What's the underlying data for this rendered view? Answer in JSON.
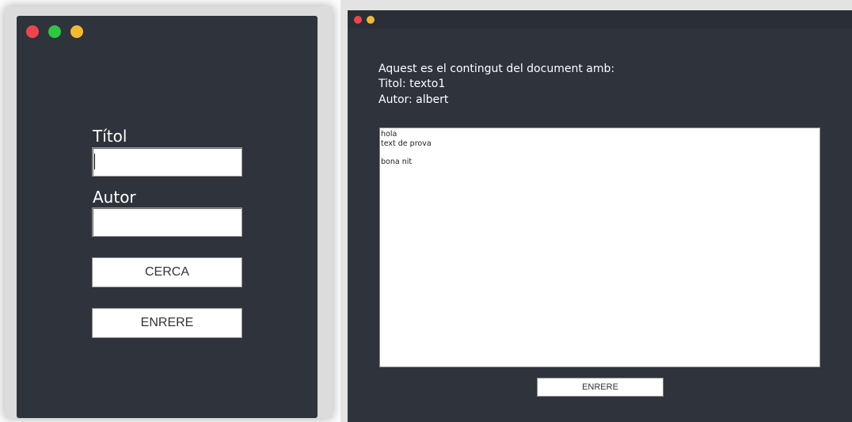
{
  "search_window": {
    "title_label": "Títol",
    "author_label": "Autor",
    "title_value": "",
    "author_value": "",
    "search_button": "CERCA",
    "back_button": "ENRERE",
    "colors": {
      "background": "#2e333c",
      "close": "#f0444d",
      "maximize": "#2bc840",
      "minimize": "#f5b930"
    }
  },
  "document_window": {
    "intro": "Aquest es el contingut del document amb:",
    "title_line": "Titol: texto1",
    "author_line": "Autor: albert",
    "content": "hola\ntext de prova\n\nbona nit",
    "back_button": "ENRERE",
    "colors": {
      "background": "#2e333c",
      "close": "#f0444d",
      "minimize": "#f5b930"
    }
  }
}
